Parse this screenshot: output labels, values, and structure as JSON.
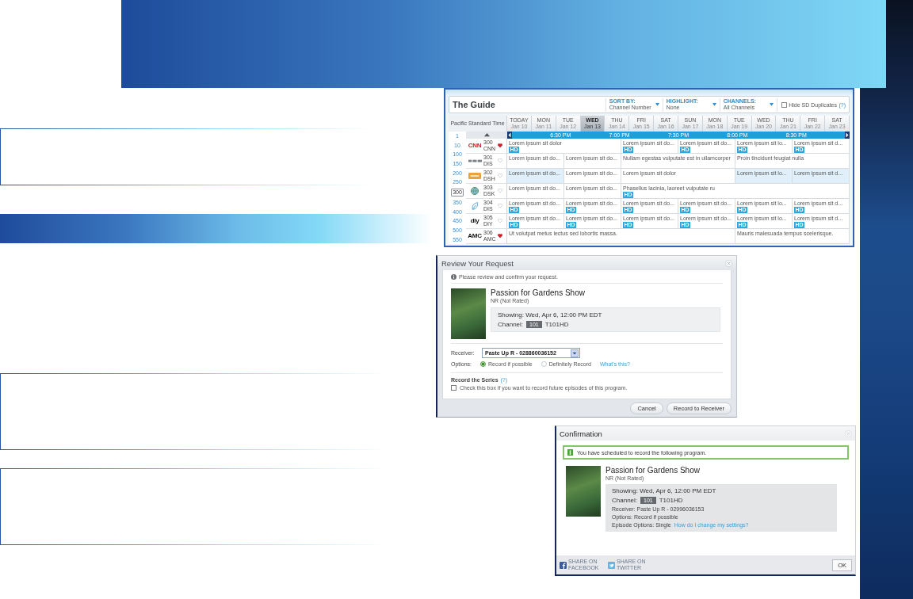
{
  "guide": {
    "title": "The Guide",
    "filters": [
      {
        "label": "SORT BY:",
        "value": "Channel Number"
      },
      {
        "label": "HIGHLIGHT:",
        "value": "None"
      },
      {
        "label": "CHANNELS:",
        "value": "All Channels"
      }
    ],
    "hide_duplicates": {
      "label": "Hide SD Duplicates",
      "help": "(?)",
      "checked": false
    },
    "timezone": "Pacific Standard Time",
    "days": [
      {
        "day": "TODAY",
        "date": "Jan 10",
        "selected": false
      },
      {
        "day": "MON",
        "date": "Jan 11",
        "selected": false
      },
      {
        "day": "TUE",
        "date": "Jan 12",
        "selected": false
      },
      {
        "day": "WED",
        "date": "Jan 13",
        "selected": true
      },
      {
        "day": "THU",
        "date": "Jan 14",
        "selected": false
      },
      {
        "day": "FRI",
        "date": "Jan 15",
        "selected": false
      },
      {
        "day": "SAT",
        "date": "Jan 16",
        "selected": false
      },
      {
        "day": "SUN",
        "date": "Jan 17",
        "selected": false
      },
      {
        "day": "MON",
        "date": "Jan 18",
        "selected": false
      },
      {
        "day": "TUE",
        "date": "Jan 19",
        "selected": false
      },
      {
        "day": "WED",
        "date": "Jan 20",
        "selected": false
      },
      {
        "day": "THU",
        "date": "Jan 21",
        "selected": false
      },
      {
        "day": "FRI",
        "date": "Jan 22",
        "selected": false
      },
      {
        "day": "SAT",
        "date": "Jan 23",
        "selected": false
      }
    ],
    "times": [
      "6:30 PM",
      "7:00 PM",
      "7:30 PM",
      "8:00 PM",
      "8:30 PM"
    ],
    "channel_numbers": [
      {
        "label": "1",
        "selected": false
      },
      {
        "label": "10",
        "selected": false
      },
      {
        "label": "100",
        "selected": false
      },
      {
        "label": "150",
        "selected": false
      },
      {
        "label": "200",
        "selected": false
      },
      {
        "label": "250",
        "selected": false
      },
      {
        "label": "300",
        "selected": true
      },
      {
        "label": "350",
        "selected": false
      },
      {
        "label": "400",
        "selected": false
      },
      {
        "label": "450",
        "selected": false
      },
      {
        "label": "500",
        "selected": false
      },
      {
        "label": "550",
        "selected": false
      }
    ],
    "channels": [
      {
        "number": "300",
        "call_sign": "CNN",
        "logo": {
          "kind": "text",
          "text": "CNN",
          "color": "#d0202a"
        },
        "favorite": true,
        "programs": [
          {
            "kind": "double",
            "title": "Lorem ipsum sit dolor",
            "badge": "HD",
            "highlighted": false
          },
          {
            "kind": "single",
            "title": "Lorem ipsum sit do...",
            "badge": "HD",
            "highlighted": false
          },
          {
            "kind": "single",
            "title": "Lorem ipsum sit do...",
            "badge": "HD",
            "highlighted": false
          },
          {
            "kind": "single",
            "title": "Lorem ipsum sit lo...",
            "badge": "HD",
            "highlighted": false
          },
          {
            "kind": "single",
            "title": "Lorem ipsum sit d...",
            "badge": "HD",
            "highlighted": false
          }
        ]
      },
      {
        "number": "301",
        "call_sign": "DIS",
        "logo": {
          "kind": "bars"
        },
        "favorite": false,
        "programs": [
          {
            "kind": "single",
            "title": "Lorem ipsum sit do...",
            "highlighted": false
          },
          {
            "kind": "single",
            "title": "Lorem ipsum sit do...",
            "highlighted": false
          },
          {
            "kind": "double",
            "title": "Nullam egestas vulputate est in ullamcorper",
            "highlighted": false
          },
          {
            "kind": "double",
            "title": "Proin tincidunt feugiat nulla",
            "highlighted": false
          }
        ]
      },
      {
        "number": "302",
        "call_sign": "DSH",
        "logo": {
          "kind": "tile",
          "color": "#e9a33c"
        },
        "favorite": false,
        "programs": [
          {
            "kind": "single",
            "title": "Lorem ipsum sit do...",
            "highlighted": true
          },
          {
            "kind": "single",
            "title": "Lorem ipsum sit do...",
            "highlighted": false
          },
          {
            "kind": "double",
            "title": "Lorem ipsum sit dolor",
            "highlighted": false
          },
          {
            "kind": "single",
            "title": "Lorem ipsum sit lo...",
            "highlighted": true
          },
          {
            "kind": "single",
            "title": "Lorem ipsum sit d...",
            "highlighted": true
          }
        ]
      },
      {
        "number": "303",
        "call_sign": "DSK",
        "logo": {
          "kind": "globe"
        },
        "favorite": false,
        "programs": [
          {
            "kind": "single",
            "title": "Lorem ipsum sit do...",
            "highlighted": false
          },
          {
            "kind": "single",
            "title": "Lorem ipsum sit do...",
            "highlighted": false
          },
          {
            "kind": "quadruple",
            "title": "Phasellus lacinia, laoreet vulputate ru",
            "badge": "HD",
            "highlighted": false
          }
        ]
      },
      {
        "number": "304",
        "call_sign": "DIS",
        "logo": {
          "kind": "leaf"
        },
        "favorite": false,
        "programs": [
          {
            "kind": "single",
            "title": "Lorem ipsum sit do...",
            "badge": "HD",
            "highlighted": false
          },
          {
            "kind": "single",
            "title": "Lorem ipsum sit do...",
            "badge": "HD",
            "highlighted": false
          },
          {
            "kind": "single",
            "title": "Lorem ipsum sit do...",
            "badge": "HD",
            "highlighted": false
          },
          {
            "kind": "single",
            "title": "Lorem ipsum sit do...",
            "badge": "HD",
            "highlighted": false
          },
          {
            "kind": "single",
            "title": "Lorem ipsum sit lo...",
            "badge": "HD",
            "highlighted": false
          },
          {
            "kind": "single",
            "title": "Lorem ipsum sit d...",
            "badge": "HD",
            "highlighted": false
          }
        ]
      },
      {
        "number": "305",
        "call_sign": "DIY",
        "logo": {
          "kind": "text",
          "text": "diy",
          "color": "#111111"
        },
        "favorite": false,
        "programs": [
          {
            "kind": "single",
            "title": "Lorem ipsum sit do...",
            "badge": "HD",
            "highlighted": false
          },
          {
            "kind": "single",
            "title": "Lorem ipsum sit do...",
            "badge": "HD",
            "highlighted": false
          },
          {
            "kind": "single",
            "title": "Lorem ipsum sit do...",
            "badge": "HD",
            "highlighted": false
          },
          {
            "kind": "single",
            "title": "Lorem ipsum sit do...",
            "badge": "HD",
            "highlighted": false
          },
          {
            "kind": "single",
            "title": "Lorem ipsum sit lo...",
            "badge": "HD",
            "highlighted": false
          },
          {
            "kind": "single",
            "title": "Lorem ipsum sit d...",
            "badge": "HD",
            "highlighted": false
          }
        ]
      },
      {
        "number": "306",
        "call_sign": "AMC",
        "logo": {
          "kind": "text",
          "text": "AMC",
          "color": "#111111"
        },
        "favorite": true,
        "programs": [
          {
            "kind": "quadruple",
            "title": "Ut volutpat metus lectus sed lobortis massa.",
            "highlighted": false
          },
          {
            "kind": "double",
            "title": "Mauris malesuada tempus scelerisque.",
            "highlighted": false
          }
        ]
      }
    ]
  },
  "review": {
    "title": "Review Your Request",
    "instruction": "Please review and confirm your request.",
    "program": {
      "title": "Passion for Gardens Show",
      "rating": "NR (Not Rated)",
      "showing": "Showing: Wed, Apr 6, 12:00 PM EDT",
      "channel_label": "Channel:",
      "channel_number": "101",
      "channel_name": "T101HD"
    },
    "receiver": {
      "label": "Receiver:",
      "value": "Paste Up R - 028860036152"
    },
    "options": {
      "label": "Options:",
      "choices": [
        {
          "label": "Record if possible",
          "selected": true
        },
        {
          "label": "Definitely Record",
          "selected": false
        }
      ],
      "help_link": "What's this?"
    },
    "series": {
      "title": "Record the Series",
      "help": "(?)",
      "label": "Check this box if you want to record future episodes of this program.",
      "checked": false
    },
    "buttons": [
      "Cancel",
      "Record to Receiver"
    ]
  },
  "confirmation": {
    "title": "Confirmation",
    "message": "You have scheduled to record the following program.",
    "program": {
      "title": "Passion for Gardens Show",
      "rating": "NR (Not Rated)",
      "showing": "Showing: Wed, Apr 6, 12:00 PM EDT",
      "channel_label": "Channel:",
      "channel_number": "101",
      "channel_name": "T101HD"
    },
    "details": [
      {
        "text": "Receiver: Paste Up R - 02996036153"
      },
      {
        "text": "Options: Record if possible"
      },
      {
        "text": "Episode Options: Single",
        "link": "How do I change my settings?"
      }
    ],
    "share": [
      {
        "kind": "facebook",
        "label": "SHARE ON FACEBOOK"
      },
      {
        "kind": "twitter",
        "label": "SHARE ON TWITTER"
      }
    ],
    "button": "OK"
  }
}
